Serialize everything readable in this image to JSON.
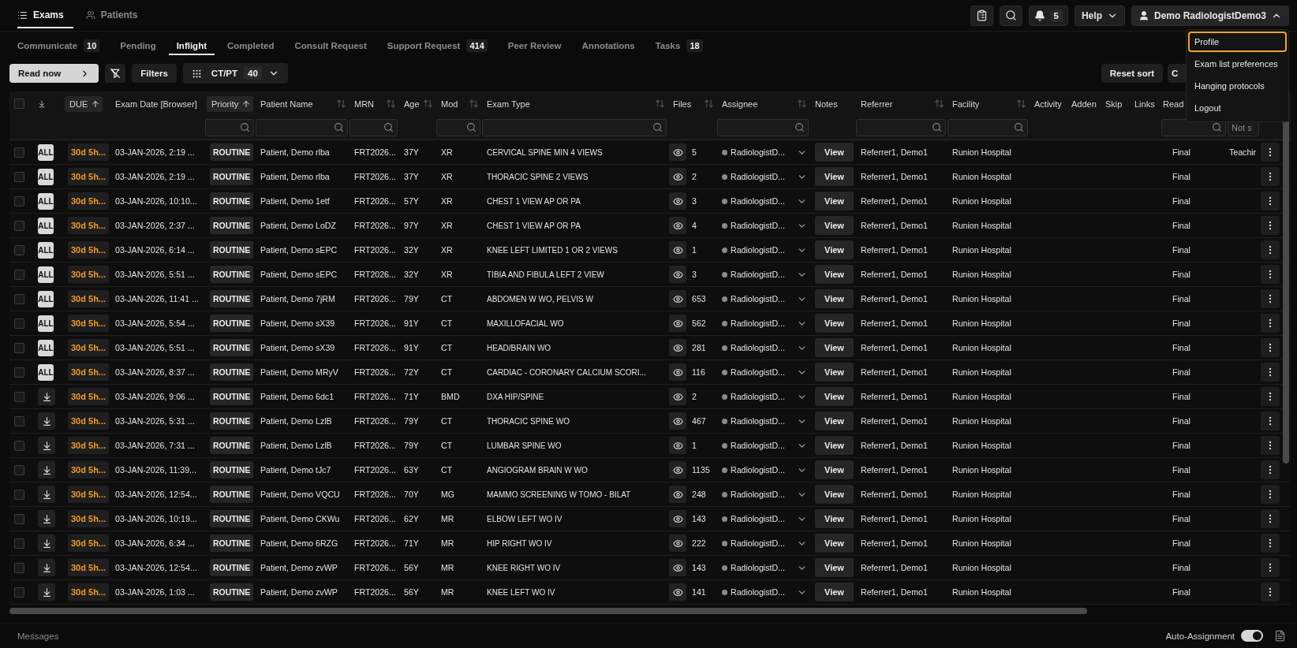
{
  "nav_tabs": [
    {
      "label": "Exams",
      "selected": true
    },
    {
      "label": "Patients",
      "selected": false
    }
  ],
  "top_actions": {
    "notifications_count": "5",
    "help": "Help",
    "user": "Demo RadiologistDemo3",
    "user_menu_expanded": true
  },
  "user_menu": [
    {
      "label": "Profile",
      "selected": true
    },
    {
      "label": "Exam list preferences",
      "selected": false
    },
    {
      "label": "Hanging protocols",
      "selected": false
    },
    {
      "label": "Logout",
      "selected": false
    }
  ],
  "worklist_tabs": [
    {
      "label": "Communicate",
      "count": "10",
      "selected": false
    },
    {
      "label": "Pending",
      "selected": false
    },
    {
      "label": "Inflight",
      "selected": true
    },
    {
      "label": "Completed",
      "selected": false
    },
    {
      "label": "Consult Request",
      "selected": false
    },
    {
      "label": "Support Request",
      "count": "414",
      "selected": false
    },
    {
      "label": "Peer Review",
      "selected": false
    },
    {
      "label": "Annotations",
      "selected": false
    },
    {
      "label": "Tasks",
      "count": "18",
      "selected": false
    }
  ],
  "toolbar": {
    "read_now": "Read now",
    "filters": "Filters",
    "modality_filter": "CT/PT",
    "modality_count": "40",
    "reset_sort": "Reset sort",
    "partial_button": "C"
  },
  "table": {
    "select_all_checked": false,
    "columns": [
      {
        "label": "DUE",
        "sorted": true
      },
      {
        "label": "Exam Date [Browser]"
      },
      {
        "label": "Priority",
        "sorted": true,
        "filter": true
      },
      {
        "label": "Patient Name",
        "sorted": false,
        "filter": true
      },
      {
        "label": "MRN",
        "sorted": false,
        "filter": true
      },
      {
        "label": "Age",
        "sorted": false
      },
      {
        "label": "Mod",
        "sorted": false,
        "filter": true
      },
      {
        "label": "Exam Type",
        "sorted": false,
        "filter": true
      },
      {
        "label": "Files",
        "sorted": false
      },
      {
        "label": "Assignee",
        "sorted": false,
        "filter": true
      },
      {
        "label": "Notes"
      },
      {
        "label": "Referrer",
        "sorted": false,
        "filter": true
      },
      {
        "label": "Facility",
        "sorted": false,
        "filter": true
      },
      {
        "label": "Activity"
      },
      {
        "label": "Adden"
      },
      {
        "label": "Skip"
      },
      {
        "label": "Links"
      },
      {
        "label": "Read",
        "filter": true
      },
      {
        "filter": true,
        "placeholder": "Not s"
      }
    ],
    "rows": [
      {
        "checked": false,
        "kind": "all",
        "badge": "ALL",
        "due": "30d 5h...",
        "exam_date": "03-JAN-2026, 2:19 ...",
        "priority": "ROUTINE",
        "patient": "Patient, Demo rlba",
        "mrn": "FRT2026...",
        "age": "37Y",
        "mod": "XR",
        "exam_type": "CERVICAL SPINE MIN 4 VIEWS",
        "files": "5",
        "assignee": "RadiologistD...",
        "notes": "View",
        "referrer": "Referrer1, Demo1",
        "facility": "Runion Hospital",
        "read": "Final",
        "last": "Teachir"
      },
      {
        "checked": false,
        "kind": "all",
        "badge": "ALL",
        "due": "30d 5h...",
        "exam_date": "03-JAN-2026, 2:19 ...",
        "priority": "ROUTINE",
        "patient": "Patient, Demo rlba",
        "mrn": "FRT2026...",
        "age": "37Y",
        "mod": "XR",
        "exam_type": "THORACIC SPINE 2 VIEWS",
        "files": "2",
        "assignee": "RadiologistD...",
        "notes": "View",
        "referrer": "Referrer1, Demo1",
        "facility": "Runion Hospital",
        "read": "Final"
      },
      {
        "checked": false,
        "kind": "all",
        "badge": "ALL",
        "due": "30d 5h...",
        "exam_date": "03-JAN-2026, 10:10...",
        "priority": "ROUTINE",
        "patient": "Patient, Demo 1etf",
        "mrn": "FRT2026...",
        "age": "57Y",
        "mod": "XR",
        "exam_type": "CHEST 1 VIEW AP OR PA",
        "files": "3",
        "assignee": "RadiologistD...",
        "notes": "View",
        "referrer": "Referrer1, Demo1",
        "facility": "Runion Hospital",
        "read": "Final"
      },
      {
        "checked": false,
        "kind": "all",
        "badge": "ALL",
        "due": "30d 5h...",
        "exam_date": "03-JAN-2026, 2:37 ...",
        "priority": "ROUTINE",
        "patient": "Patient, Demo LoDZ",
        "mrn": "FRT2026...",
        "age": "97Y",
        "mod": "XR",
        "exam_type": "CHEST 1 VIEW AP OR PA",
        "files": "4",
        "assignee": "RadiologistD...",
        "notes": "View",
        "referrer": "Referrer1, Demo1",
        "facility": "Runion Hospital",
        "read": "Final"
      },
      {
        "checked": false,
        "kind": "all",
        "badge": "ALL",
        "due": "30d 5h...",
        "exam_date": "03-JAN-2026, 6:14 ...",
        "priority": "ROUTINE",
        "patient": "Patient, Demo sEPC",
        "mrn": "FRT2026...",
        "age": "32Y",
        "mod": "XR",
        "exam_type": "KNEE LEFT LIMITED 1 OR 2 VIEWS",
        "files": "1",
        "assignee": "RadiologistD...",
        "notes": "View",
        "referrer": "Referrer1, Demo1",
        "facility": "Runion Hospital",
        "read": "Final"
      },
      {
        "checked": false,
        "kind": "all",
        "badge": "ALL",
        "due": "30d 5h...",
        "exam_date": "03-JAN-2026, 5:51 ...",
        "priority": "ROUTINE",
        "patient": "Patient, Demo sEPC",
        "mrn": "FRT2026...",
        "age": "32Y",
        "mod": "XR",
        "exam_type": "TIBIA AND FIBULA LEFT 2 VIEW",
        "files": "3",
        "assignee": "RadiologistD...",
        "notes": "View",
        "referrer": "Referrer1, Demo1",
        "facility": "Runion Hospital",
        "read": "Final"
      },
      {
        "checked": false,
        "kind": "all",
        "badge": "ALL",
        "due": "30d 5h...",
        "exam_date": "03-JAN-2026, 11:41 ...",
        "priority": "ROUTINE",
        "patient": "Patient, Demo 7jRM",
        "mrn": "FRT2026...",
        "age": "79Y",
        "mod": "CT",
        "exam_type": "ABDOMEN W WO, PELVIS W",
        "files": "653",
        "assignee": "RadiologistD...",
        "notes": "View",
        "referrer": "Referrer1, Demo1",
        "facility": "Runion Hospital",
        "read": "Final"
      },
      {
        "checked": false,
        "kind": "all",
        "badge": "ALL",
        "due": "30d 5h...",
        "exam_date": "03-JAN-2026, 5:54 ...",
        "priority": "ROUTINE",
        "patient": "Patient, Demo sX39",
        "mrn": "FRT2026...",
        "age": "91Y",
        "mod": "CT",
        "exam_type": "MAXILLOFACIAL WO",
        "files": "562",
        "assignee": "RadiologistD...",
        "notes": "View",
        "referrer": "Referrer1, Demo1",
        "facility": "Runion Hospital",
        "read": "Final"
      },
      {
        "checked": false,
        "kind": "all",
        "badge": "ALL",
        "due": "30d 5h...",
        "exam_date": "03-JAN-2026, 5:51 ...",
        "priority": "ROUTINE",
        "patient": "Patient, Demo sX39",
        "mrn": "FRT2026...",
        "age": "91Y",
        "mod": "CT",
        "exam_type": "HEAD/BRAIN WO",
        "files": "281",
        "assignee": "RadiologistD...",
        "notes": "View",
        "referrer": "Referrer1, Demo1",
        "facility": "Runion Hospital",
        "read": "Final"
      },
      {
        "checked": false,
        "kind": "all",
        "badge": "ALL",
        "due": "30d 5h...",
        "exam_date": "03-JAN-2026, 8:37 ...",
        "priority": "ROUTINE",
        "patient": "Patient, Demo MRyV",
        "mrn": "FRT2026...",
        "age": "72Y",
        "mod": "CT",
        "exam_type": "CARDIAC - CORONARY CALCIUM SCORI...",
        "files": "116",
        "assignee": "RadiologistD...",
        "notes": "View",
        "referrer": "Referrer1, Demo1",
        "facility": "Runion Hospital",
        "read": "Final"
      },
      {
        "checked": false,
        "kind": "download",
        "due": "30d 5h...",
        "exam_date": "03-JAN-2026, 9:06 ...",
        "priority": "ROUTINE",
        "patient": "Patient, Demo 6dc1",
        "mrn": "FRT2026...",
        "age": "71Y",
        "mod": "BMD",
        "exam_type": "DXA HIP/SPINE",
        "files": "2",
        "assignee": "RadiologistD...",
        "notes": "View",
        "referrer": "Referrer1, Demo1",
        "facility": "Runion Hospital",
        "read": "Final"
      },
      {
        "checked": false,
        "kind": "download",
        "due": "30d 5h...",
        "exam_date": "03-JAN-2026, 5:31 ...",
        "priority": "ROUTINE",
        "patient": "Patient, Demo LzlB",
        "mrn": "FRT2026...",
        "age": "79Y",
        "mod": "CT",
        "exam_type": "THORACIC SPINE WO",
        "files": "467",
        "assignee": "RadiologistD...",
        "notes": "View",
        "referrer": "Referrer1, Demo1",
        "facility": "Runion Hospital",
        "read": "Final"
      },
      {
        "checked": false,
        "kind": "download",
        "due": "30d 5h...",
        "exam_date": "03-JAN-2026, 7:31 ...",
        "priority": "ROUTINE",
        "patient": "Patient, Demo LzlB",
        "mrn": "FRT2026...",
        "age": "79Y",
        "mod": "CT",
        "exam_type": "LUMBAR SPINE WO",
        "files": "1",
        "assignee": "RadiologistD...",
        "notes": "View",
        "referrer": "Referrer1, Demo1",
        "facility": "Runion Hospital",
        "read": "Final"
      },
      {
        "checked": false,
        "kind": "download",
        "due": "30d 5h...",
        "exam_date": "03-JAN-2026, 11:39...",
        "priority": "ROUTINE",
        "patient": "Patient, Demo tJc7",
        "mrn": "FRT2026...",
        "age": "63Y",
        "mod": "CT",
        "exam_type": "ANGIOGRAM BRAIN W WO",
        "files": "1135",
        "assignee": "RadiologistD...",
        "notes": "View",
        "referrer": "Referrer1, Demo1",
        "facility": "Runion Hospital",
        "read": "Final"
      },
      {
        "checked": false,
        "kind": "download",
        "due": "30d 5h...",
        "exam_date": "03-JAN-2026, 12:54...",
        "priority": "ROUTINE",
        "patient": "Patient, Demo VQCU",
        "mrn": "FRT2026...",
        "age": "70Y",
        "mod": "MG",
        "exam_type": "MAMMO SCREENING W TOMO - BILAT",
        "files": "248",
        "assignee": "RadiologistD...",
        "notes": "View",
        "referrer": "Referrer1, Demo1",
        "facility": "Runion Hospital",
        "read": "Final"
      },
      {
        "checked": false,
        "kind": "download",
        "due": "30d 5h...",
        "exam_date": "03-JAN-2026, 10:19...",
        "priority": "ROUTINE",
        "patient": "Patient, Demo CKWu",
        "mrn": "FRT2026...",
        "age": "62Y",
        "mod": "MR",
        "exam_type": "ELBOW LEFT WO IV",
        "files": "143",
        "assignee": "RadiologistD...",
        "notes": "View",
        "referrer": "Referrer1, Demo1",
        "facility": "Runion Hospital",
        "read": "Final"
      },
      {
        "checked": false,
        "kind": "download",
        "due": "30d 5h...",
        "exam_date": "03-JAN-2026, 6:34 ...",
        "priority": "ROUTINE",
        "patient": "Patient, Demo 6RZG",
        "mrn": "FRT2026...",
        "age": "71Y",
        "mod": "MR",
        "exam_type": "HIP RIGHT WO IV",
        "files": "222",
        "assignee": "RadiologistD...",
        "notes": "View",
        "referrer": "Referrer1, Demo1",
        "facility": "Runion Hospital",
        "read": "Final"
      },
      {
        "checked": false,
        "kind": "download",
        "due": "30d 5h...",
        "exam_date": "03-JAN-2026, 12:54...",
        "priority": "ROUTINE",
        "patient": "Patient, Demo zvWP",
        "mrn": "FRT2026...",
        "age": "56Y",
        "mod": "MR",
        "exam_type": "KNEE RIGHT WO IV",
        "files": "143",
        "assignee": "RadiologistD...",
        "notes": "View",
        "referrer": "Referrer1, Demo1",
        "facility": "Runion Hospital",
        "read": "Final"
      },
      {
        "checked": false,
        "kind": "download",
        "due": "30d 5h...",
        "exam_date": "03-JAN-2026, 1:03 ...",
        "priority": "ROUTINE",
        "patient": "Patient, Demo zvWP",
        "mrn": "FRT2026...",
        "age": "56Y",
        "mod": "MR",
        "exam_type": "KNEE LEFT WO IV",
        "files": "141",
        "assignee": "RadiologistD...",
        "notes": "View",
        "referrer": "Referrer1, Demo1",
        "facility": "Runion Hospital",
        "read": "Final"
      }
    ]
  },
  "footer": {
    "messages": "Messages",
    "auto_assignment": "Auto-Assignment",
    "auto_assignment_on": true
  }
}
